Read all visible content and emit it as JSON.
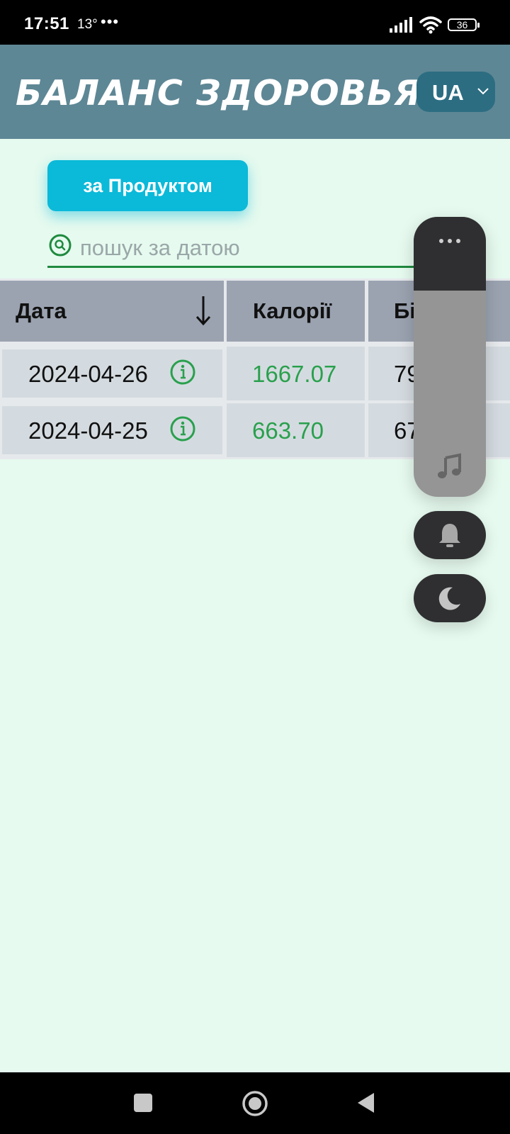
{
  "status_bar": {
    "time": "17:51",
    "temperature": "13°",
    "more": "•••",
    "battery": "36"
  },
  "header": {
    "title": "БАЛАНС ЗДОРОВЬЯ",
    "language": "UA"
  },
  "product_button": "за Продуктом",
  "search": {
    "placeholder": "пошук за датою",
    "value": ""
  },
  "table": {
    "columns": [
      "Дата",
      "Калорії",
      "Бі"
    ],
    "rows": [
      {
        "date": "2024-04-26",
        "calories": "1667.07",
        "protein": "79"
      },
      {
        "date": "2024-04-25",
        "calories": "663.70",
        "protein": "67"
      }
    ]
  },
  "colors": {
    "background": "#e6faef",
    "header": "#5e8795",
    "accent_button": "#0bb9d9",
    "calories_text": "#29a04d",
    "panel_dark": "#2f2f31"
  },
  "icons": {
    "sort": "arrow-down-icon",
    "row_info": "info-icon",
    "search": "search-icon",
    "panel_menu": "more-icon",
    "panel_sound": "music-icon",
    "panel_notify": "bell-icon",
    "panel_theme": "moon-icon"
  }
}
